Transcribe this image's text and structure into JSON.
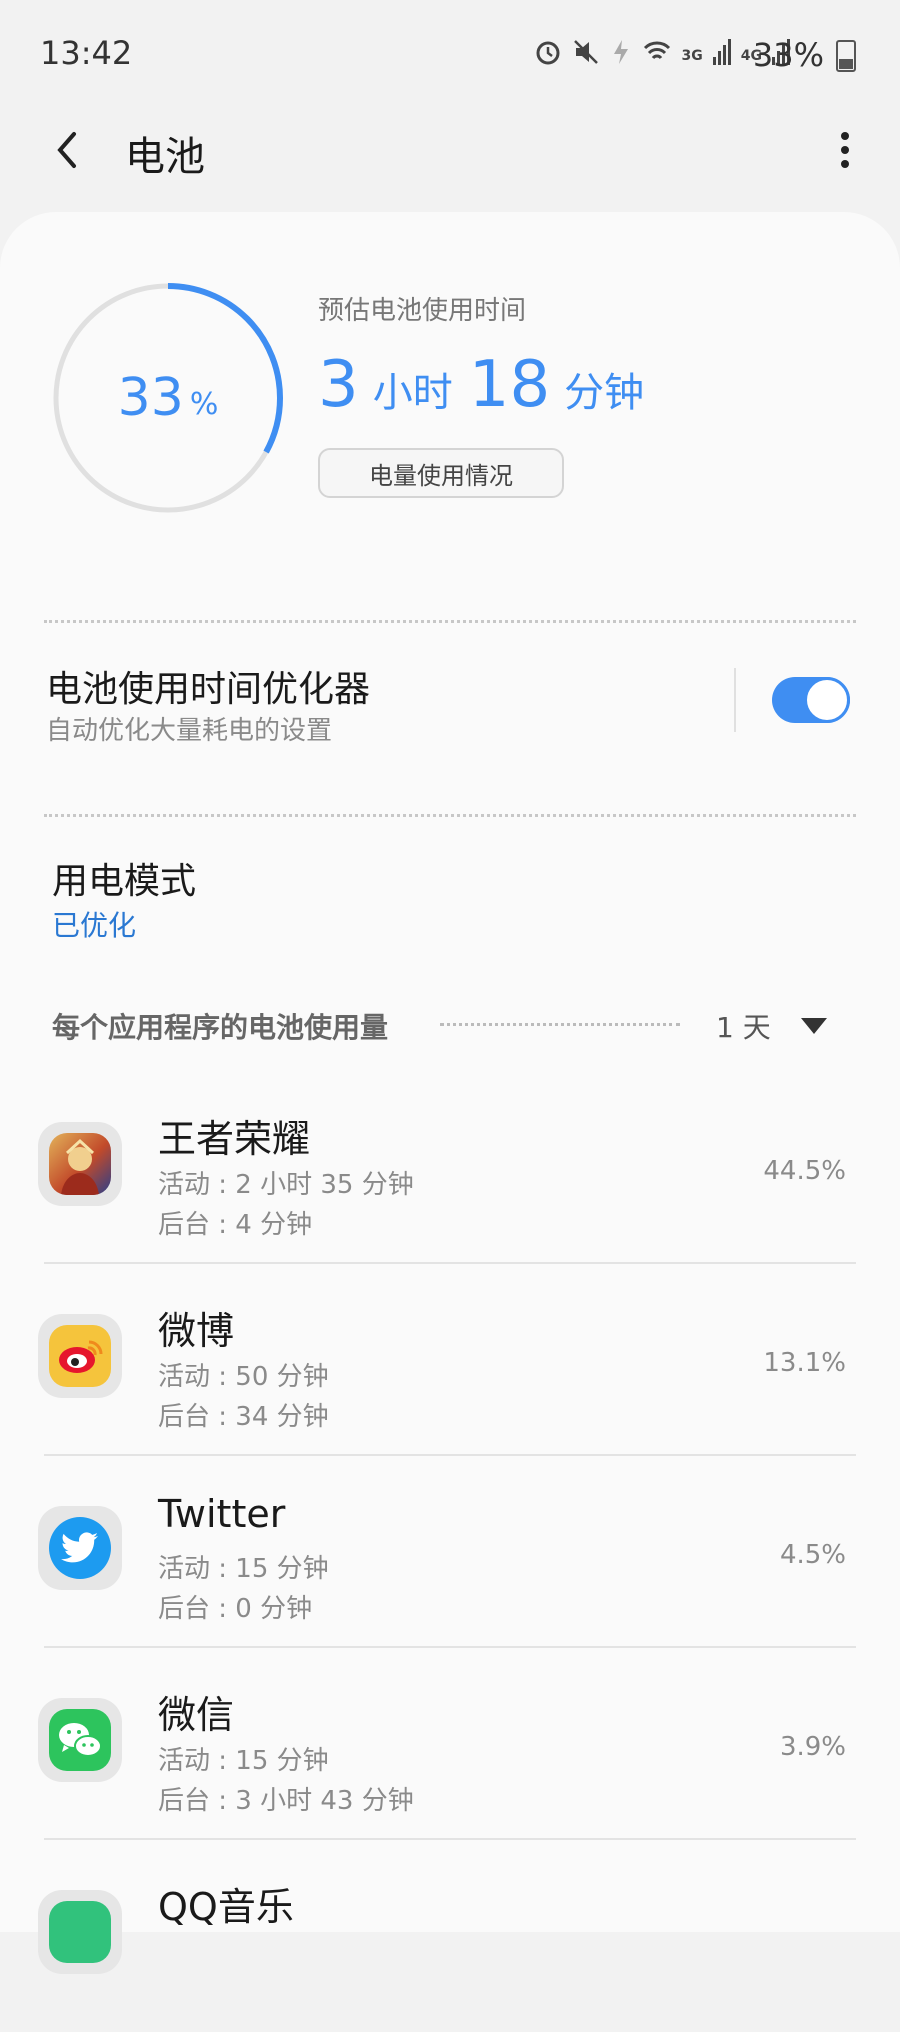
{
  "status_bar": {
    "time": "13:42",
    "icons": [
      "alarm-icon",
      "mute-icon",
      "data-saver-icon",
      "wifi-icon",
      "3g-signal-icon",
      "4g-signal-icon"
    ],
    "net_3g": "3G",
    "net_4g": "4G",
    "battery": "33%"
  },
  "app_bar": {
    "title": "电池"
  },
  "battery_summary": {
    "percent": "33",
    "percent_unit": "%",
    "level_fraction": 0.33,
    "estimate_label": "预估电池使用时间",
    "hours": "3",
    "hours_unit": "小时",
    "minutes": "18",
    "minutes_unit": "分钟",
    "usage_button": "电量使用情况"
  },
  "optimizer": {
    "title": "电池使用时间优化器",
    "subtitle": "自动优化大量耗电的设置",
    "enabled": true
  },
  "power_mode": {
    "title": "用电模式",
    "value": "已优化"
  },
  "per_app": {
    "header": "每个应用程序的电池使用量",
    "period": "1 天"
  },
  "apps": [
    {
      "name": "王者荣耀",
      "active": "活动 : 2 小时 35 分钟",
      "background": "后台 : 4 分钟",
      "percent": "44.5%",
      "icon": "honor-of-kings-icon"
    },
    {
      "name": "微博",
      "active": "活动 : 50 分钟",
      "background": "后台 : 34 分钟",
      "percent": "13.1%",
      "icon": "weibo-icon"
    },
    {
      "name": "Twitter",
      "active": "活动 : 15 分钟",
      "background": "后台 : 0 分钟",
      "percent": "4.5%",
      "icon": "twitter-icon"
    },
    {
      "name": "微信",
      "active": "活动 : 15 分钟",
      "background": "后台 : 3 小时 43 分钟",
      "percent": "3.9%",
      "icon": "wechat-icon"
    },
    {
      "name": "QQ音乐",
      "active": "",
      "background": "",
      "percent": "",
      "icon": "qq-music-icon"
    }
  ],
  "colors": {
    "accent": "#3f8ef2",
    "link": "#2a78d2",
    "weibo": "#f5c43c",
    "twitter": "#1d9bf0",
    "wechat": "#2dc45d"
  }
}
